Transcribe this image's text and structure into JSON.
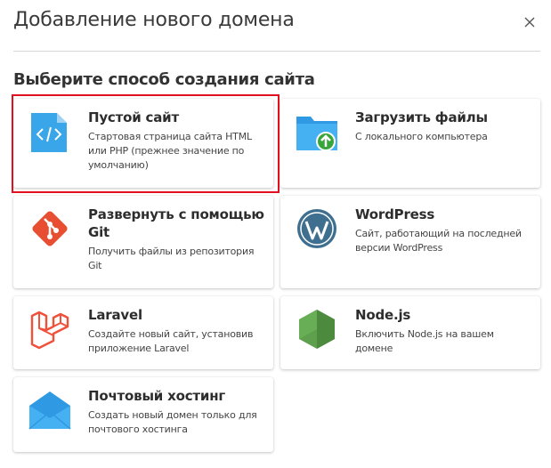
{
  "dialog": {
    "title": "Добавление нового домена",
    "section_title": "Выберите способ создания сайта"
  },
  "options": [
    {
      "name": "Пустой сайт",
      "desc": "Стартовая страница сайта HTML или PHP (прежнее значение по умолчанию)",
      "icon": "code-file-icon",
      "selected": true
    },
    {
      "name": "Загрузить файлы",
      "desc": "С локального компьютера",
      "icon": "folder-upload-icon"
    },
    {
      "name": "Развернуть с помощью Git",
      "desc": "Получить файлы из репозитория Git",
      "icon": "git-icon"
    },
    {
      "name": "WordPress",
      "desc": "Сайт, работающий на последней версии WordPress",
      "icon": "wordpress-icon"
    },
    {
      "name": "Laravel",
      "desc": "Создайте новый сайт, установив приложение Laravel",
      "icon": "laravel-icon"
    },
    {
      "name": "Node.js",
      "desc": "Включить Node.js на вашем домене",
      "icon": "nodejs-icon"
    },
    {
      "name": "Почтовый хостинг",
      "desc": "Создать новый домен только для почтового хостинга",
      "icon": "mail-icon"
    }
  ],
  "colors": {
    "selection": "#e0101f",
    "blue_icon": "#35a2e8",
    "git": "#e84e31",
    "wordpress": "#3f6f8f",
    "laravel": "#f0513a",
    "node": "#5fa04e"
  }
}
